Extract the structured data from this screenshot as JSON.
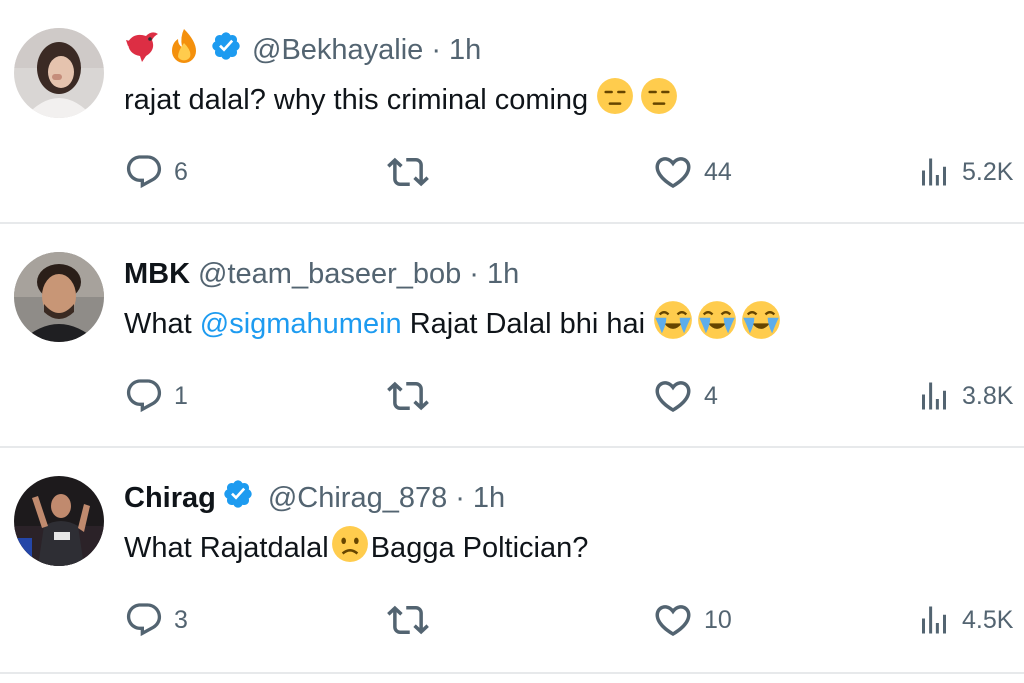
{
  "tweets": [
    {
      "name": "",
      "name_emojis": [
        "bird-emoji",
        "fire-emoji"
      ],
      "verified": true,
      "handle": "@Bekhayalie",
      "separator": "·",
      "time": "1h",
      "text_parts": [
        "rajat dalal? why this criminal coming "
      ],
      "text_emojis": [
        "expressionless-face-emoji",
        "expressionless-face-emoji"
      ],
      "replies": "6",
      "retweets": "",
      "likes": "44",
      "views": "5.2K"
    },
    {
      "name": "MBK",
      "verified": false,
      "handle": "@team_baseer_bob",
      "separator": "·",
      "time": "1h",
      "text_before": "What ",
      "mention": "@sigmahumein",
      "text_after": " Rajat Dalal bhi hai ",
      "text_emojis": [
        "loudly-crying-face-emoji",
        "loudly-crying-face-emoji",
        "loudly-crying-face-emoji"
      ],
      "replies": "1",
      "retweets": "",
      "likes": "4",
      "views": "3.8K"
    },
    {
      "name": "Chirag",
      "verified": true,
      "handle": "@Chirag_878",
      "separator": "·",
      "time": "1h",
      "text_before": "What Rajatdalal",
      "text_after": "Bagga Poltician?",
      "text_emojis": [
        "frowning-face-emoji"
      ],
      "replies": "3",
      "retweets": "",
      "likes": "10",
      "views": "4.5K"
    }
  ],
  "colors": {
    "text_primary": "#0f1419",
    "text_secondary": "#536471",
    "link": "#1d9bf0",
    "verified": "#1d9bf0",
    "divider": "#e7e9eb"
  }
}
